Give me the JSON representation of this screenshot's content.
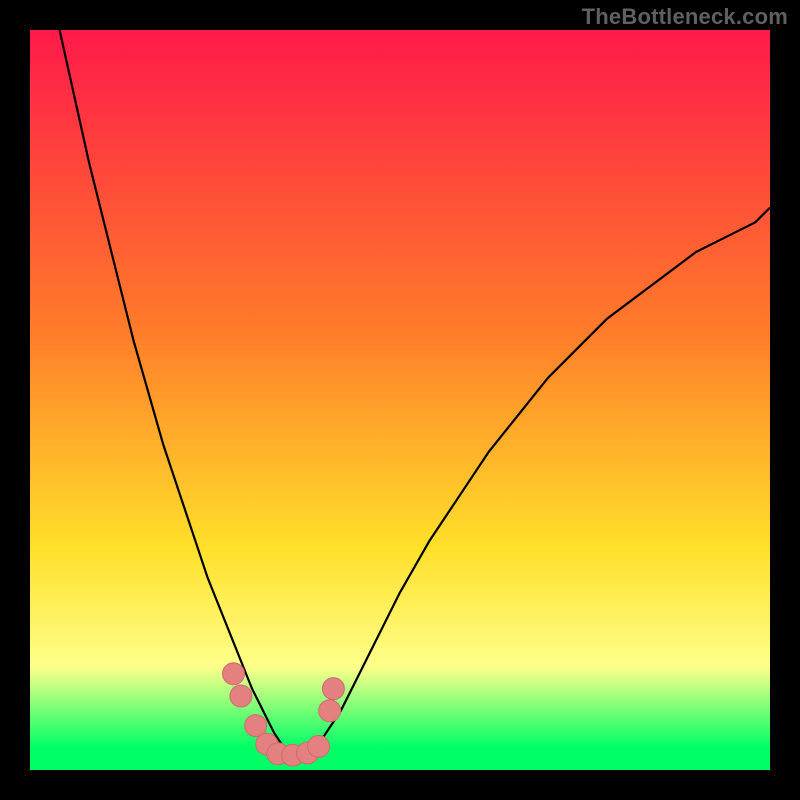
{
  "watermark": "TheBottleneck.com",
  "colors": {
    "page_bg": "#000000",
    "curve": "#000000",
    "marker_fill": "#e48080",
    "marker_stroke": "#c86c6c",
    "grad_top": "#ff1a4a",
    "grad_mid1": "#ff7a2a",
    "grad_mid2": "#ffe02a",
    "grad_band": "#ffff8a",
    "grad_bottom": "#00ff66"
  },
  "chart_data": {
    "type": "line",
    "title": "",
    "xlabel": "",
    "ylabel": "",
    "xlim": [
      0,
      100
    ],
    "ylim": [
      0,
      100
    ],
    "series": [
      {
        "name": "bottleneck-curve",
        "x": [
          0,
          2,
          4,
          6,
          8,
          10,
          12,
          14,
          16,
          18,
          20,
          22,
          24,
          26,
          28,
          30,
          31,
          32,
          33,
          34,
          35,
          36,
          37,
          38,
          39,
          40,
          42,
          44,
          46,
          48,
          50,
          54,
          58,
          62,
          66,
          70,
          74,
          78,
          82,
          86,
          90,
          94,
          98,
          100
        ],
        "y": [
          120,
          110,
          100,
          91,
          82,
          74,
          66,
          58,
          51,
          44,
          38,
          32,
          26,
          21,
          16,
          11,
          9,
          7,
          5,
          3.5,
          2.5,
          2,
          2,
          2.5,
          3.5,
          5,
          8,
          12,
          16,
          20,
          24,
          31,
          37,
          43,
          48,
          53,
          57,
          61,
          64,
          67,
          70,
          72,
          74,
          76
        ]
      }
    ],
    "markers": [
      {
        "x": 27.5,
        "y": 13
      },
      {
        "x": 28.5,
        "y": 10
      },
      {
        "x": 30.5,
        "y": 6
      },
      {
        "x": 32,
        "y": 3.5
      },
      {
        "x": 33.5,
        "y": 2.2
      },
      {
        "x": 35.5,
        "y": 2
      },
      {
        "x": 37.5,
        "y": 2.3
      },
      {
        "x": 39,
        "y": 3.2
      },
      {
        "x": 40.5,
        "y": 8
      },
      {
        "x": 41,
        "y": 11
      }
    ],
    "gradient_stops": [
      {
        "pos": 0.0,
        "key": "grad_top"
      },
      {
        "pos": 0.4,
        "key": "grad_mid1"
      },
      {
        "pos": 0.7,
        "key": "grad_mid2"
      },
      {
        "pos": 0.86,
        "key": "grad_band"
      },
      {
        "pos": 0.97,
        "key": "grad_bottom"
      },
      {
        "pos": 1.0,
        "key": "grad_bottom"
      }
    ]
  }
}
